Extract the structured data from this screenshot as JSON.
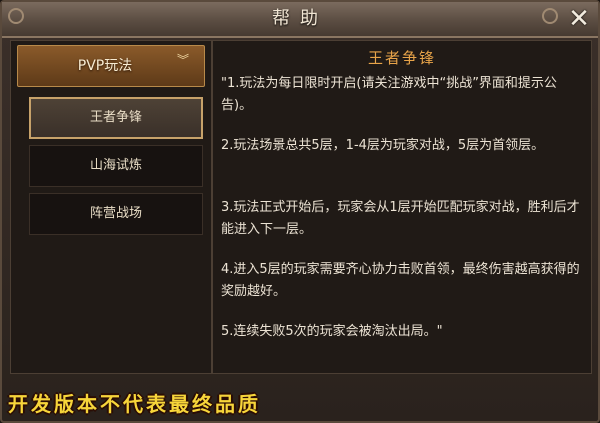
{
  "window": {
    "title": "帮助",
    "close_icon": "close-x-icon"
  },
  "sidebar": {
    "category": {
      "label": "PVP玩法",
      "icon": "chevron-down-icon"
    },
    "items": [
      {
        "label": "王者争锋",
        "selected": true
      },
      {
        "label": "山海试炼",
        "selected": false
      },
      {
        "label": "阵营战场",
        "selected": false
      }
    ]
  },
  "content": {
    "title": "王者争锋",
    "paragraphs": [
      "\"1.玩法为每日限时开启(请关注游戏中“挑战”界面和提示公告)。",
      "2.玩法场景总共5层，1-4层为玩家对战，5层为首领层。",
      "3.玩法正式开始后，玩家会从1层开始匹配玩家对战，胜利后才能进入下一层。",
      "4.进入5层的玩家需要齐心协力击败首领，最终伤害越高获得的奖励越好。",
      "5.连续失败5次的玩家会被淘汰出局。\""
    ]
  },
  "footer": {
    "watermark": "开发版本不代表最终品质"
  },
  "colors": {
    "title_accent": "#e8a449",
    "footer_text": "#f7d53a",
    "selected_border": "#c7a26a"
  }
}
